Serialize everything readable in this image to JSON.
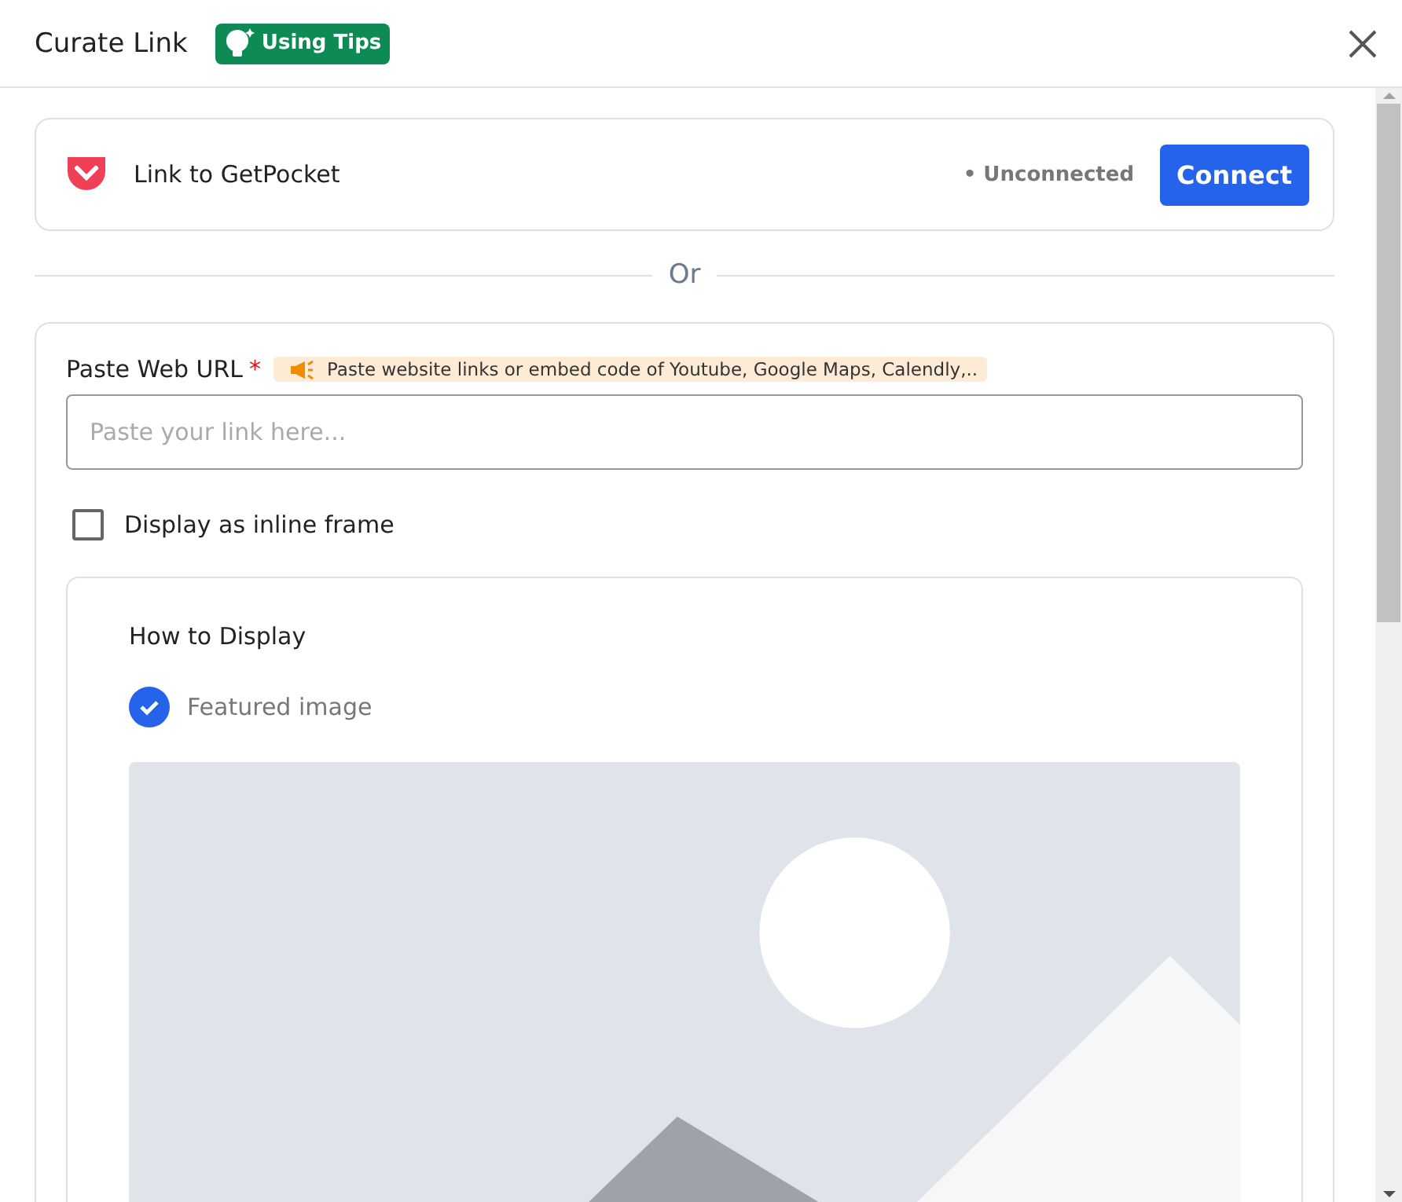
{
  "window": {
    "title": "Curate Link",
    "tips_badge": "Using Tips"
  },
  "pocket": {
    "label": "Link to GetPocket",
    "status": "• Unconnected",
    "connect_button": "Connect"
  },
  "divider_text": "Or",
  "url_field": {
    "label": "Paste Web URL",
    "required_mark": "*",
    "hint": "Paste website links or embed code of Youtube, Google Maps, Calendly,..",
    "placeholder": "Paste your link here..."
  },
  "inline_frame": {
    "label": "Display as inline frame",
    "checked": false
  },
  "how_to_display": {
    "title": "How to Display",
    "options": [
      {
        "label": "Featured image",
        "checked": true
      }
    ]
  }
}
